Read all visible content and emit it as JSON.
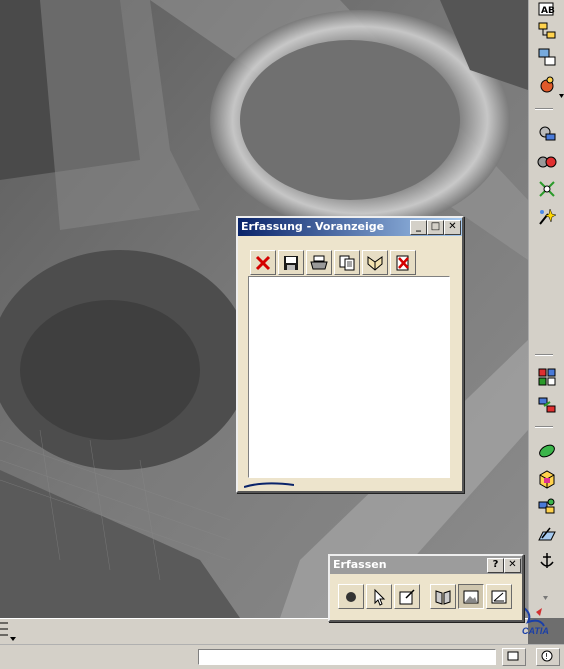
{
  "preview_window": {
    "title": "Erfassung - Voranzeige",
    "toolbar": {
      "delete_icon": "red-x-icon",
      "save_icon": "floppy-disk-icon",
      "print_icon": "printer-icon",
      "copy_icon": "copy-pages-icon",
      "album_icon": "album-icon",
      "album_delete_icon": "album-delete-icon"
    },
    "title_buttons": {
      "minimize": "_",
      "maximize": "□",
      "close": "✕"
    }
  },
  "capture_window": {
    "title": "Erfassen",
    "title_buttons": {
      "help": "?",
      "close": "✕"
    },
    "tools": [
      "capture-icon",
      "select-mode-icon",
      "options-icon",
      "album-icon",
      "pixel-mode-icon",
      "vector-mode-icon"
    ]
  },
  "right_toolbar": {
    "icons": [
      "annotation-text-icon",
      "tree-structure-icon",
      "product-structure-icon",
      "catalog-icon",
      "measure-icon",
      "analysis-icon",
      "grid-snap-icon",
      "sparkle-icon",
      "multi-view-icon",
      "swap-icon",
      "filter-icon",
      "cube-icon",
      "assembly-icon",
      "plane-icon",
      "anchor-icon"
    ]
  },
  "brand": {
    "logo_text": "CATIA",
    "accent": "#1a3fa8"
  },
  "colors": {
    "title_start": "#0a246a",
    "title_end": "#a6caf0",
    "panel": "#ede4cc",
    "chrome": "#d4d0c8"
  }
}
